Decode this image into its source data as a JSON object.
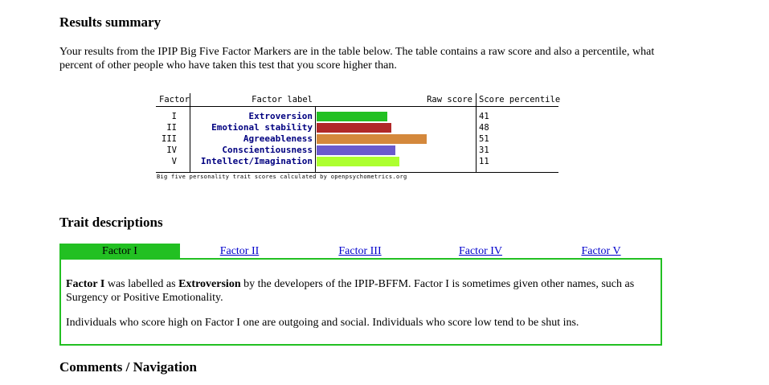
{
  "headings": {
    "results": "Results summary",
    "traits": "Trait descriptions",
    "comments": "Comments / Navigation"
  },
  "intro": "Your results from the IPIP Big Five Factor Markers are in the table below. The table contains a raw score and also a percentile, what percent of other people who have taken this test that you score higher than.",
  "table": {
    "headers": {
      "factor": "Factor",
      "label": "Factor label",
      "raw": "Raw score",
      "percentile": "Score percentile"
    },
    "rows": [
      {
        "factor": "I",
        "label": "Extroversion",
        "percentile": "41",
        "raw_fraction": 0.45,
        "color": "#22c022"
      },
      {
        "factor": "II",
        "label": "Emotional stability",
        "percentile": "48",
        "raw_fraction": 0.475,
        "color": "#b02828"
      },
      {
        "factor": "III",
        "label": "Agreeableness",
        "percentile": "51",
        "raw_fraction": 0.7,
        "color": "#d4883c"
      },
      {
        "factor": "IV",
        "label": "Conscientiousness",
        "percentile": "31",
        "raw_fraction": 0.5,
        "color": "#6a5acd"
      },
      {
        "factor": "V",
        "label": "Intellect/Imagination",
        "percentile": "11",
        "raw_fraction": 0.525,
        "color": "#adff2f"
      }
    ],
    "caption": "Big five personality trait scores calculated by openpsychometrics.org"
  },
  "tabs": [
    "Factor I",
    "Factor II",
    "Factor III",
    "Factor IV",
    "Factor V"
  ],
  "active_tab": 0,
  "accent": "#22c022",
  "panel": {
    "p1_a": "Factor I",
    "p1_b": " was labelled as ",
    "p1_c": "Extroversion",
    "p1_d": " by the developers of the IPIP-BFFM. Factor I is sometimes given other names, such as Surgency or Positive Emotionality.",
    "p2": "Individuals who score high on Factor I one are outgoing and social. Individuals who score low tend to be shut ins."
  }
}
